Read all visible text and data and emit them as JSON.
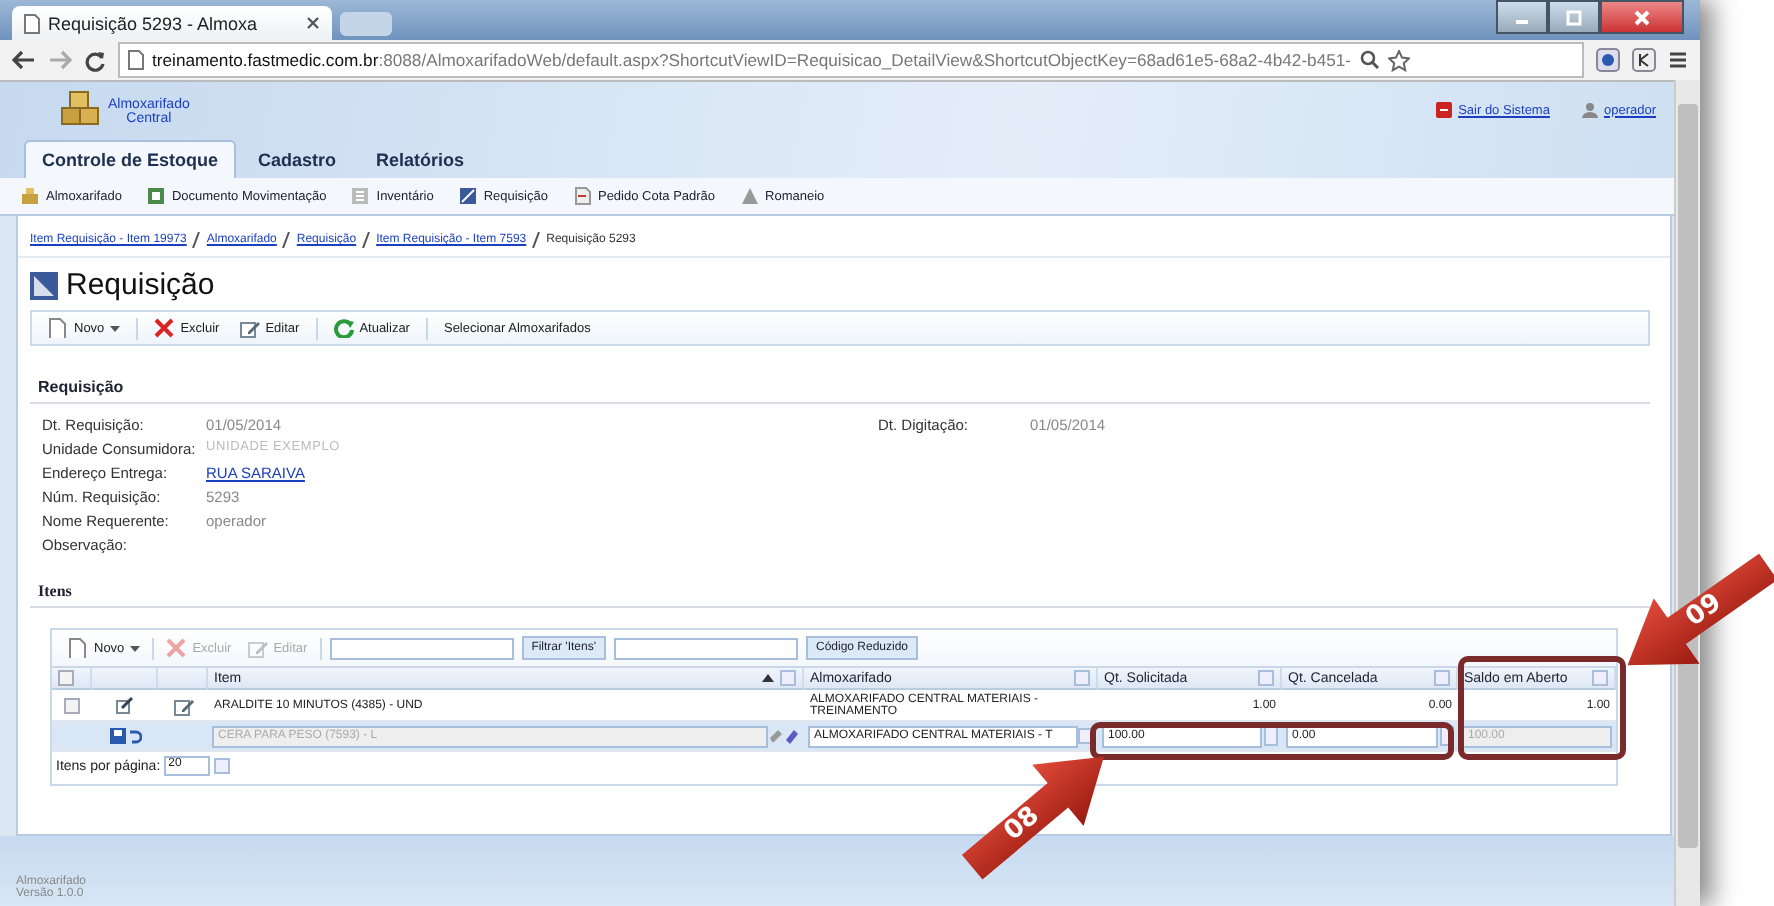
{
  "browser": {
    "tab_title": "Requisição 5293 - Almoxa",
    "url_host": "treinamento.fastmedic.com.br",
    "url_rest": ":8088/AlmoxarifadoWeb/default.aspx?ShortcutViewID=Requisicao_DetailView&ShortcutObjectKey=68ad61e5-68a2-4b42-b451-"
  },
  "app": {
    "logo_lines": [
      "Almoxarifado",
      "Central"
    ],
    "logout": "Sair do Sistema",
    "user": "operador"
  },
  "tabs": [
    {
      "label": "Controle de Estoque",
      "selected": true
    },
    {
      "label": "Cadastro",
      "selected": false
    },
    {
      "label": "Relatórios",
      "selected": false
    }
  ],
  "nav_items": [
    "Almoxarifado",
    "Documento Movimentação",
    "Inventário",
    "Requisição",
    "Pedido Cota Padrão",
    "Romaneio"
  ],
  "breadcrumb": {
    "links": [
      "Item Requisição - Item 19973",
      "Almoxarifado",
      "Requisição",
      "Item Requisição - Item 7593"
    ],
    "current": "Requisição 5293"
  },
  "title": "Requisição",
  "toolbar": [
    {
      "kind": "new",
      "label": "Novo"
    },
    {
      "kind": "delete",
      "label": "Excluir"
    },
    {
      "kind": "edit",
      "label": "Editar"
    },
    {
      "kind": "refresh",
      "label": "Atualizar"
    },
    {
      "kind": "plain",
      "label": "Selecionar Almoxarifados"
    }
  ],
  "section": "Requisição",
  "fields_left": [
    {
      "label": "Dt. Requisição:",
      "value": "01/05/2014",
      "kind": "text"
    },
    {
      "label": "Unidade Consumidora:",
      "value": "UNIDADE EXEMPLO",
      "kind": "muted"
    },
    {
      "label": "Endereço Entrega:",
      "value": "RUA SARAIVA",
      "kind": "link"
    },
    {
      "label": "Núm. Requisição:",
      "value": "5293",
      "kind": "text"
    },
    {
      "label": "Nome Requerente:",
      "value": "operador",
      "kind": "text"
    },
    {
      "label": "Observação:",
      "kind": "text"
    }
  ],
  "fields_right": [
    {
      "label": "Dt. Digitação:",
      "value": "01/05/2014"
    }
  ],
  "items": {
    "title": "Itens",
    "toolbar": [
      {
        "kind": "new",
        "label": "Novo",
        "disabled": false
      },
      {
        "kind": "delete",
        "label": "Excluir",
        "disabled": true
      },
      {
        "kind": "edit",
        "label": "Editar",
        "disabled": true
      }
    ],
    "filter_button": "Filtrar 'Itens'",
    "code_button": "Código Reduzido",
    "select_all": {
      "checked": false
    },
    "columns": [
      {
        "label": "Item",
        "sorted": true
      },
      {
        "label": "Almoxarifado",
        "sorted": false
      },
      {
        "label": "Qt. Solicitada",
        "sorted": false
      },
      {
        "label": "Qt. Cancelada",
        "sorted": false
      },
      {
        "label": "Saldo em Aberto",
        "sorted": false
      }
    ],
    "rows": [
      {
        "item": "ARALDITE 10 MINUTOS (4385) - UND",
        "almoxarifado": "ALMOXARIFADO CENTRAL MATERIAIS - TREINAMENTO",
        "qt_solicitada": "1.00",
        "qt_cancelada": "0.00",
        "saldo": "1.00",
        "checked": false
      }
    ],
    "edit_row": {
      "item": "CERA PARA PESO (7593) - L",
      "almoxarifado": "ALMOXARIFADO CENTRAL MATERIAIS - T",
      "qt_solicitada": "100.00",
      "qt_cancelada": "0.00",
      "saldo": "100.00"
    },
    "page_size_label": "Itens por página:",
    "page_size": "20"
  },
  "footer": [
    "Almoxarifado",
    "Versão 1.0.0"
  ],
  "annotations": [
    {
      "label": "08"
    },
    {
      "label": "09"
    }
  ]
}
